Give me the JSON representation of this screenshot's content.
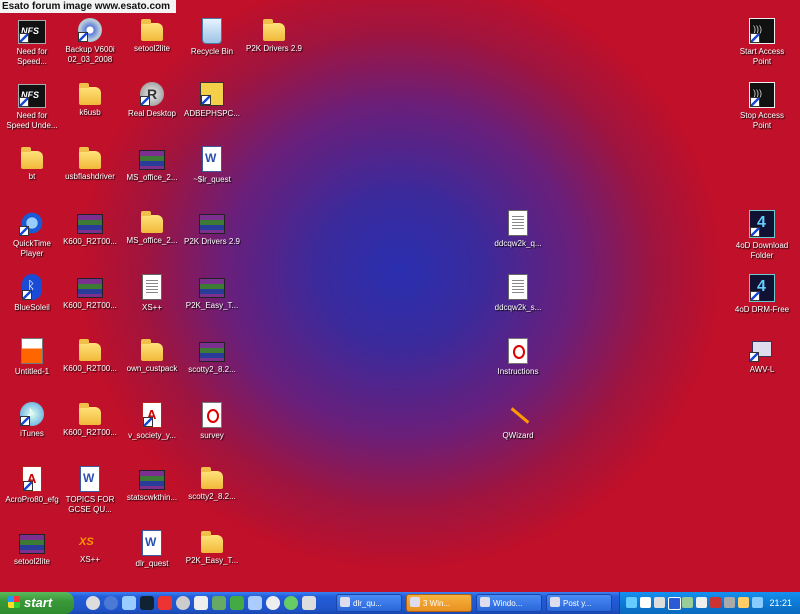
{
  "watermark": "Esato forum image www.esato.com",
  "icons": {
    "need_for_speed_1": "Need for\nSpeed...",
    "backup_v600i": "Backup V600i\n02_03_2008",
    "setool2lite_folder": "setool2lite",
    "recycle_bin": "Recycle Bin",
    "p2k_drivers_folder": "P2K Drivers 2.9",
    "need_for_speed_under": "Need for\nSpeed Unde...",
    "k6usb": "k6usb",
    "real_desktop": "Real Desktop",
    "adbephspc": "ADBEPHSPC...",
    "bt": "bt",
    "usbflashdriver": "usbflashdriver",
    "ms_office_rar": "MS_office_2...",
    "lr_quest_doc": "~$lr_quest",
    "quicktime": "QuickTime\nPlayer",
    "k600_rar_1": "K600_R2T00...",
    "ms_office_folder": "MS_office_2...",
    "p2k_drivers_rar": "P2K Drivers 2.9",
    "ddcqw2k_q": "ddcqw2k_q...",
    "c4_download": "4oD Download\nFolder",
    "bluesoleil": "BlueSoleil",
    "k600_rar_2": "K600_R2T00...",
    "xspp_file": "XS++",
    "p2k_easy_rar": "P2K_Easy_T...",
    "ddcqw2k_s": "ddcqw2k_s...",
    "c4_drm_free": "4oD DRM-Free",
    "untitled1": "Untitled-1",
    "k600_folder_1": "K600_R2T00...",
    "own_custpack": "own_custpack",
    "scotty2_rar": "scotty2_8.2...",
    "instructions": "Instructions",
    "awv_l": "AWV-L",
    "itunes": "iTunes",
    "k600_folder_2": "K600_R2T00...",
    "v_society": "v_society_y...",
    "survey": "survey",
    "qwizard": "QWizard",
    "acropro": "AcroPro80_efg",
    "topics_gcse": "TOPICS FOR\nGCSE QU...",
    "statscwk": "statscwkthin...",
    "scotty2_folder": "scotty2_8.2...",
    "setool2lite_rar": "setool2lite",
    "xspp_app": "XS++",
    "dlr_quest": "dlr_quest",
    "p2k_easy_folder": "P2K_Easy_T...",
    "start_access": "Start Access\nPoint",
    "stop_access": "Stop Access\nPoint"
  },
  "taskbar": {
    "start_label": "start",
    "buttons": [
      "dlr_qu...",
      "3 Win...",
      "Windo...",
      "Post y..."
    ],
    "clock": "21:21"
  },
  "colors": {
    "desktop_center": "#2a2fb0",
    "desktop_edge": "#c0102a",
    "taskbar": "#245edb",
    "start_button": "#3a9a3a",
    "tray": "#0c7ad6"
  }
}
